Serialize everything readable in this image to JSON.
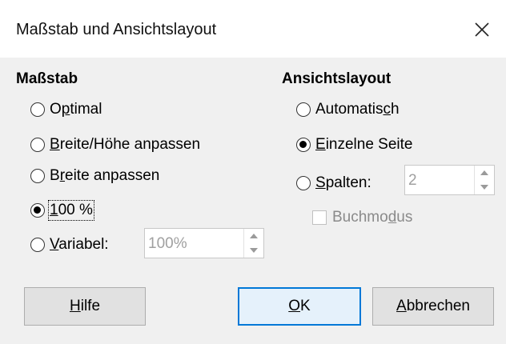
{
  "window": {
    "title": "Maßstab und Ansichtslayout",
    "close_icon": "close-icon"
  },
  "zoom": {
    "heading": "Maßstab",
    "options": [
      {
        "pre": "O",
        "u": "p",
        "post": "timal"
      },
      {
        "pre": "",
        "u": "B",
        "post": "reite/Höhe anpassen"
      },
      {
        "pre": "B",
        "u": "r",
        "post": "eite anpassen"
      },
      {
        "pre": "",
        "u": "1",
        "post": "00 %"
      },
      {
        "pre": "",
        "u": "V",
        "post": "ariabel:"
      }
    ],
    "selected_index": 3,
    "variable_value": "100%"
  },
  "layout": {
    "heading": "Ansichtslayout",
    "options": [
      {
        "pre": "Automatis",
        "u": "c",
        "post": "h"
      },
      {
        "pre": "",
        "u": "E",
        "post": "inzelne Seite"
      },
      {
        "pre": "",
        "u": "S",
        "post": "palten:"
      }
    ],
    "selected_index": 1,
    "columns_value": "2",
    "book_mode": {
      "pre": "Buchmo",
      "u": "d",
      "post": "us",
      "checked": false
    }
  },
  "buttons": {
    "help": {
      "pre": "",
      "u": "H",
      "post": "ilfe"
    },
    "ok": {
      "pre": "",
      "u": "O",
      "post": "K"
    },
    "cancel": {
      "pre": "",
      "u": "A",
      "post": "bbrechen"
    }
  },
  "colors": {
    "accent": "#0078d7",
    "client_bg": "#f0f0f0",
    "disabled_text": "#8a8a8a"
  }
}
